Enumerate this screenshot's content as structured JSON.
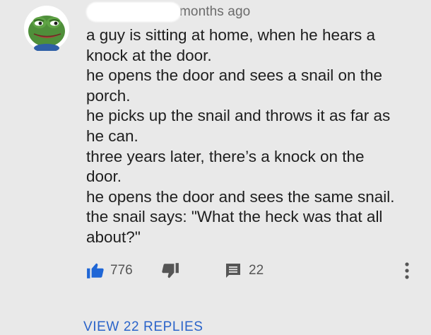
{
  "comment": {
    "avatar_icon": "pepe-frog-icon",
    "timestamp": "months ago",
    "lines": [
      "a guy is sitting at home,  when he hears a",
      "knock at the door.",
      "he opens the door and sees a snail on the",
      "porch.",
      "he picks up the snail and throws it as far as",
      "he can.",
      "three years later, there’s a knock on the",
      "door.",
      "he opens the door and sees the same snail.",
      "the snail says: \"What the heck was that all",
      "about?\""
    ]
  },
  "actions": {
    "like_icon": "thumbs-up-icon",
    "like_count": "776",
    "dislike_icon": "thumbs-down-icon",
    "reply_icon": "reply-comment-icon",
    "reply_count": "22",
    "more_icon": "more-vertical-icon"
  },
  "footer": {
    "view_replies_label": "VIEW 22 REPLIES"
  },
  "colors": {
    "background": "#e9e9e9",
    "like_active": "#1f66d6",
    "link": "#2a63c9",
    "icon_gray": "#555555"
  }
}
